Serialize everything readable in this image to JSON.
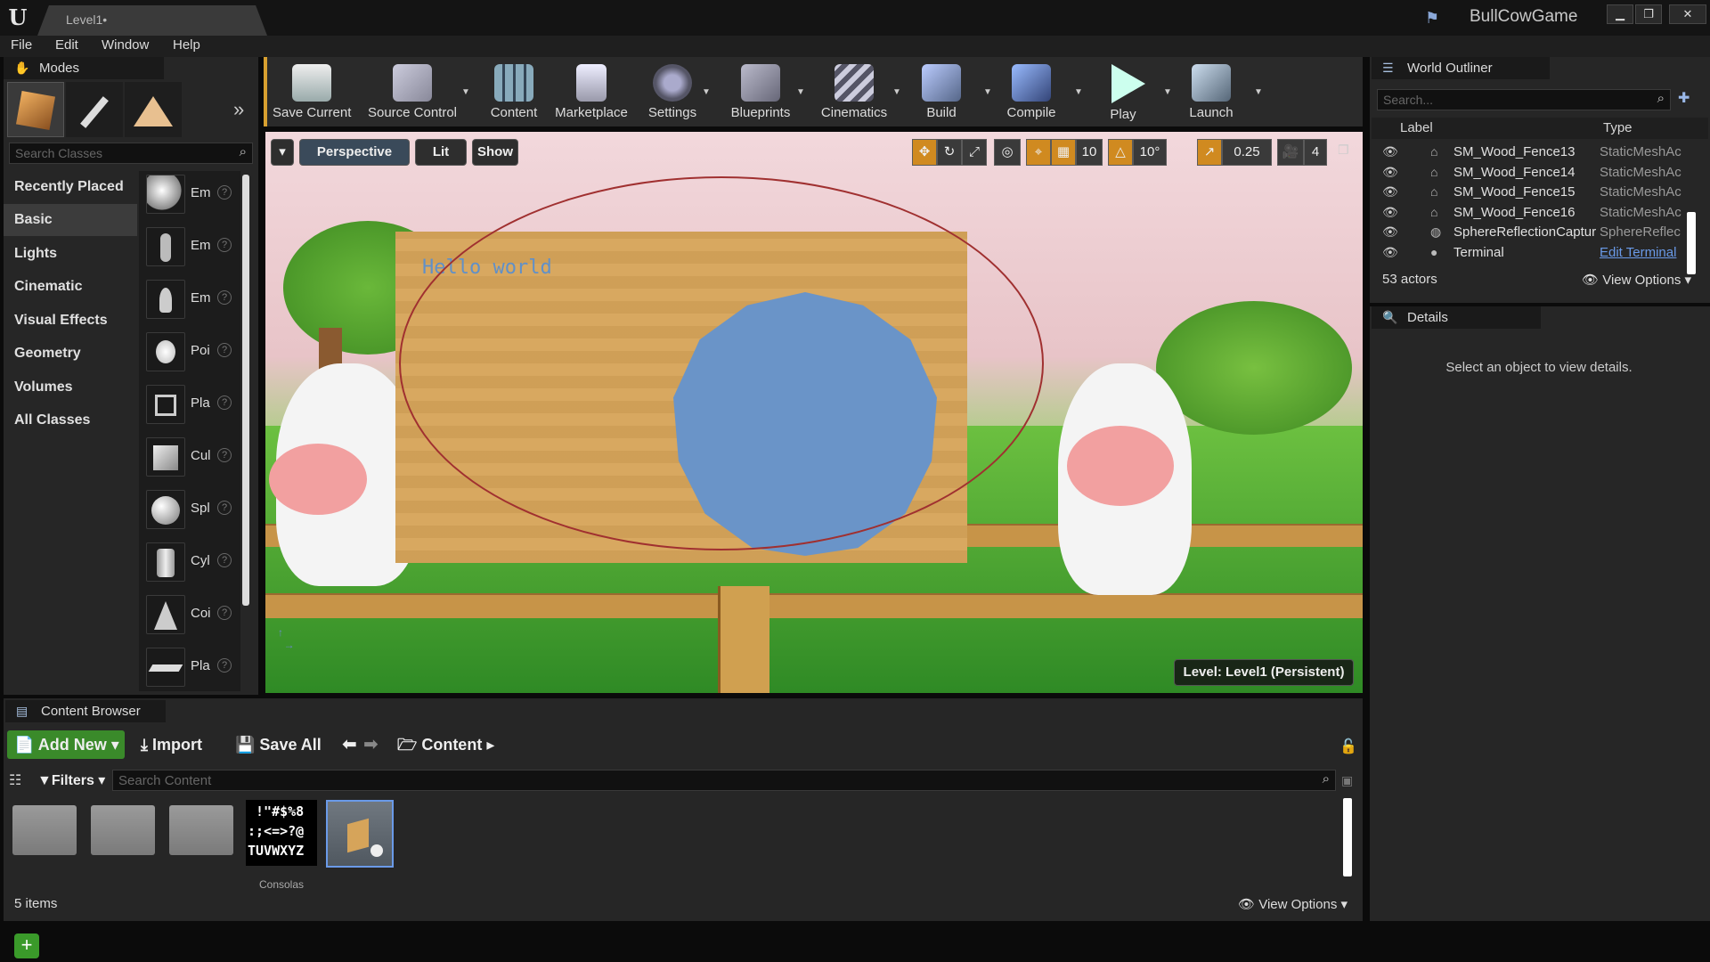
{
  "window": {
    "doc_tab": "Level1•",
    "project": "BullCowGame",
    "minimize": "▁",
    "maximize": "❐",
    "close": "✕"
  },
  "menu": [
    "File",
    "Edit",
    "Window",
    "Help"
  ],
  "modes": {
    "title": "Modes",
    "search_placeholder": "Search Classes",
    "categories": [
      "Recently Placed",
      "Basic",
      "Lights",
      "Cinematic",
      "Visual Effects",
      "Geometry",
      "Volumes",
      "All Classes"
    ],
    "items": [
      "Em",
      "Em",
      "Em",
      "Poi",
      "Pla",
      "Cul",
      "Spl",
      "Cyl",
      "Coi",
      "Pla"
    ]
  },
  "toolbar": {
    "buttons": [
      "Save Current",
      "Source Control",
      "Content",
      "Marketplace",
      "Settings",
      "Blueprints",
      "Cinematics",
      "Build",
      "Compile",
      "Play",
      "Launch"
    ]
  },
  "viewport": {
    "perspective": "Perspective",
    "lit": "Lit",
    "show": "Show",
    "grid_snap": "10",
    "rot_snap": "10°",
    "scale_snap": "0.25",
    "cam_speed": "4",
    "hello": "Hello world",
    "level_label": "Level:  Level1 (Persistent)"
  },
  "outliner": {
    "title": "World Outliner",
    "search_placeholder": "Search...",
    "col_label": "Label",
    "col_type": "Type",
    "rows": [
      {
        "name": "SM_Wood_Fence13",
        "type": "StaticMeshAc"
      },
      {
        "name": "SM_Wood_Fence14",
        "type": "StaticMeshAc"
      },
      {
        "name": "SM_Wood_Fence15",
        "type": "StaticMeshAc"
      },
      {
        "name": "SM_Wood_Fence16",
        "type": "StaticMeshAc"
      },
      {
        "name": "SphereReflectionCaptur",
        "type": "SphereReflec"
      },
      {
        "name": "Terminal",
        "type": "Edit Terminal"
      }
    ],
    "count": "53 actors",
    "view_options": "View Options"
  },
  "details": {
    "title": "Details",
    "empty": "Select an object to view details."
  },
  "content_browser": {
    "title": "Content Browser",
    "add_new": "Add New",
    "import": "Import",
    "save_all": "Save All",
    "path": "Content",
    "filters": "Filters",
    "search_placeholder": "Search Content",
    "font_preview": " !\"#$%8\n:;<=>?@\nTUVWXYZ",
    "asset_label": "Consolas",
    "count": "5 items",
    "view_options": "View Options"
  }
}
